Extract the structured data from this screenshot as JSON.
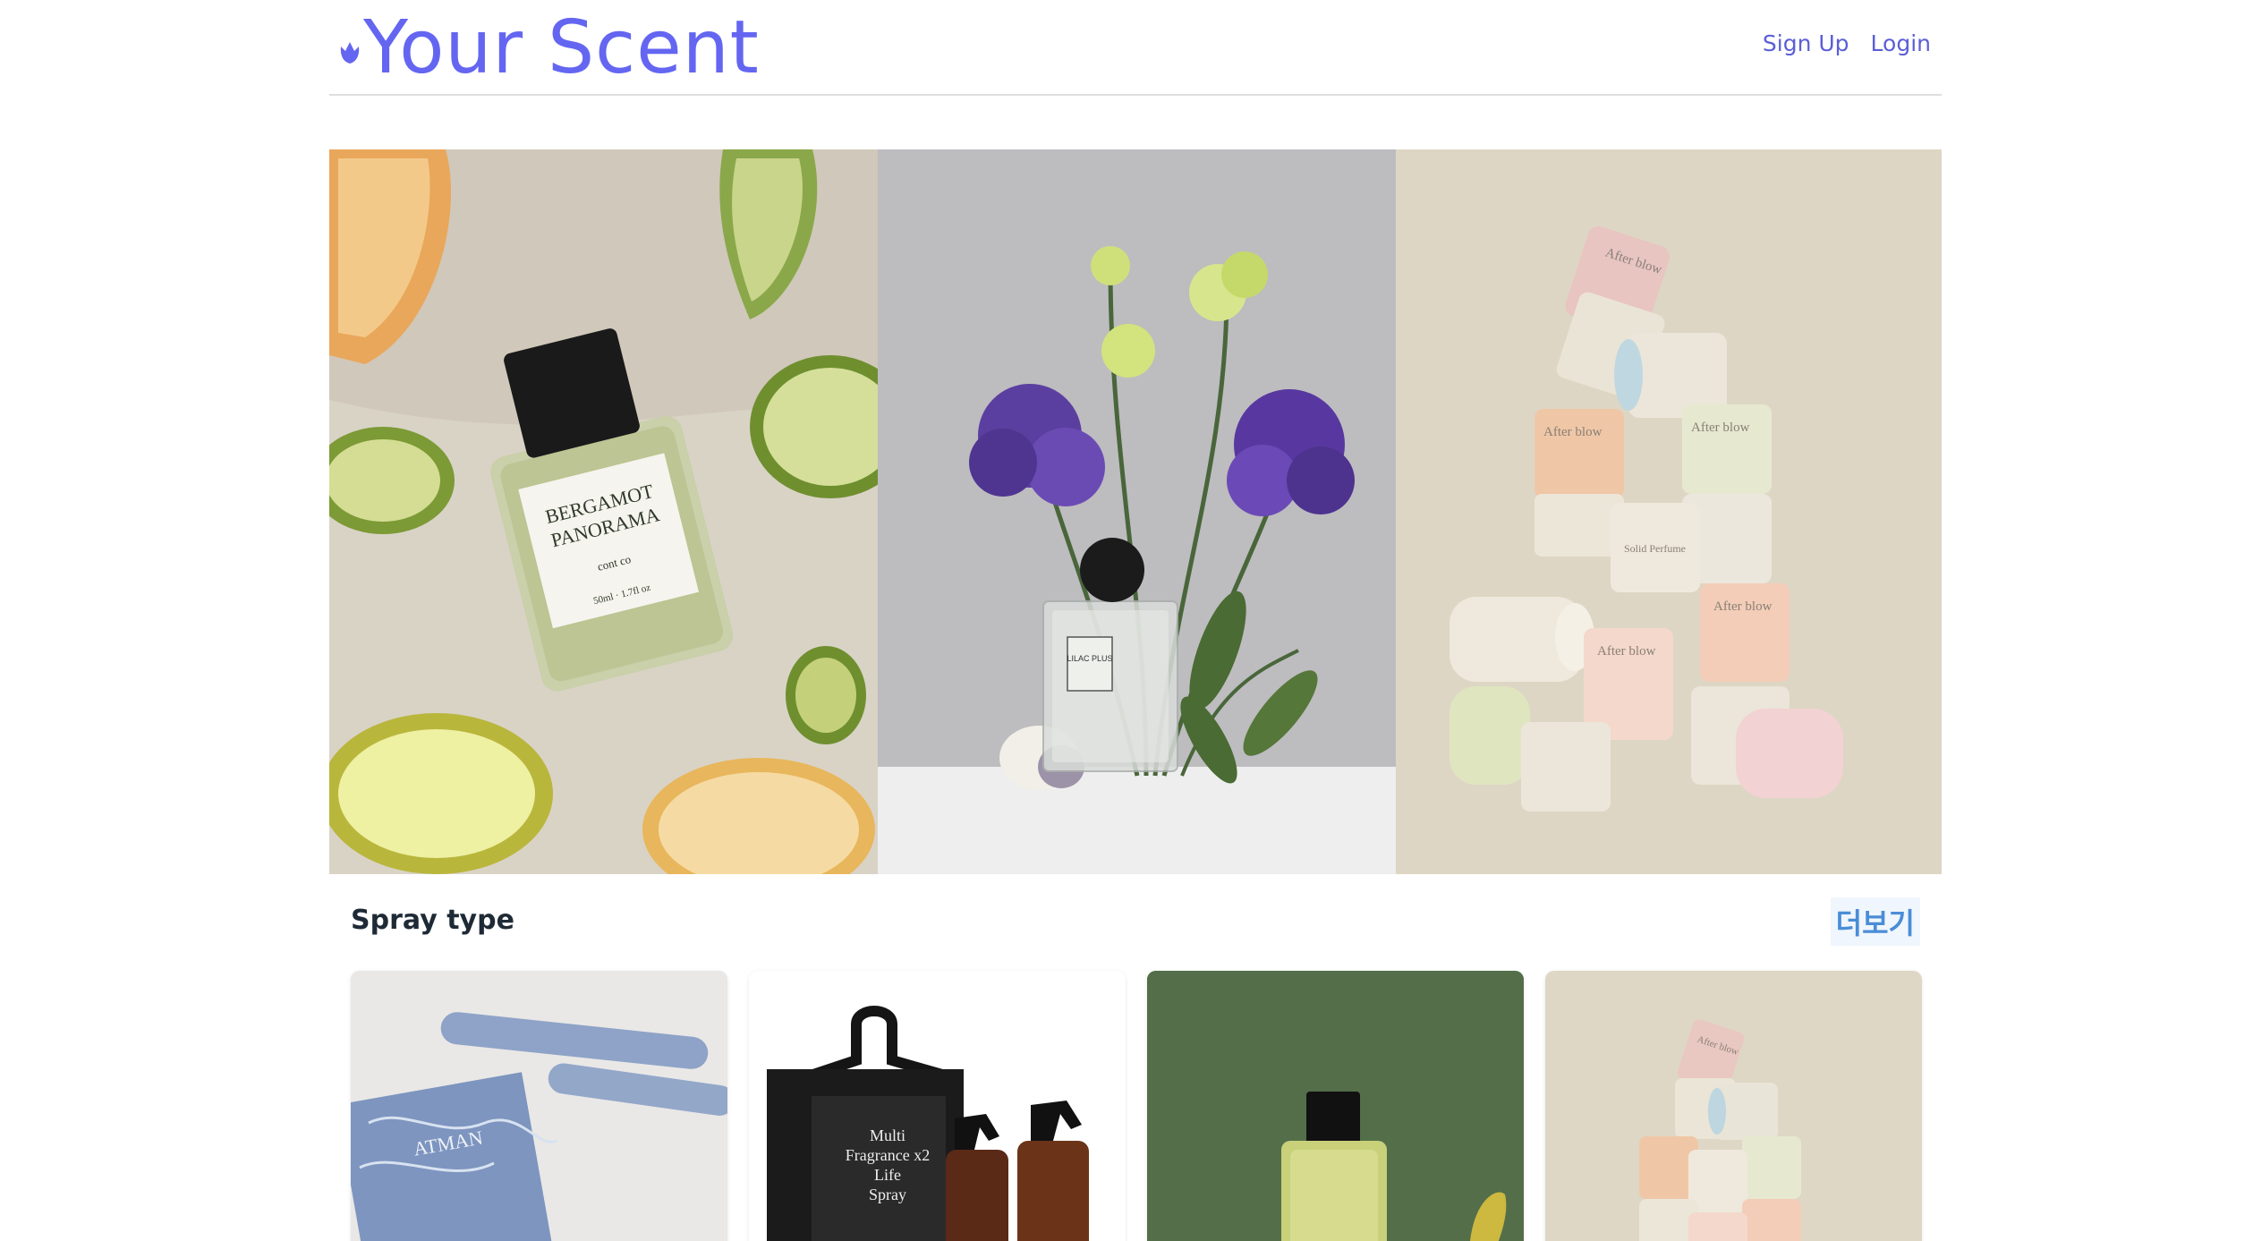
{
  "header": {
    "brand": "Your Scent",
    "brand_icon": "tulip-icon",
    "nav": {
      "signup": "Sign Up",
      "login": "Login"
    }
  },
  "hero": {
    "slides": [
      {
        "image": "bergamot-perfume-photo",
        "bottle_line1": "BERGAMOT",
        "bottle_line2": "PANORAMA",
        "bottle_volume": "50ml · 1.7fl oz",
        "bottle_logo": "cont co"
      },
      {
        "image": "lilac-perfume-flowers-photo",
        "bottle_label": "LILAC PLUS"
      },
      {
        "image": "afterblow-solid-perfume-photo",
        "brand_label": "After blow",
        "sub_label": "Solid Perfume"
      }
    ]
  },
  "section": {
    "title": "Spray type",
    "more": "더보기"
  },
  "products": [
    {
      "image": "blue-perfume-box-photo",
      "label": "ATMAN"
    },
    {
      "image": "multi-fragrance-spray-photo",
      "line1": "Multi",
      "line2": "Fragrance x2",
      "line3": "Life",
      "line4": "Spray"
    },
    {
      "image": "green-perfume-bottle-photo"
    },
    {
      "image": "afterblow-stack-photo",
      "label": "After blow"
    }
  ],
  "colors": {
    "brand": "#6466f1",
    "nav_link": "#5b5fd6",
    "more_link": "#4a8dd6",
    "title": "#1e2a35"
  }
}
